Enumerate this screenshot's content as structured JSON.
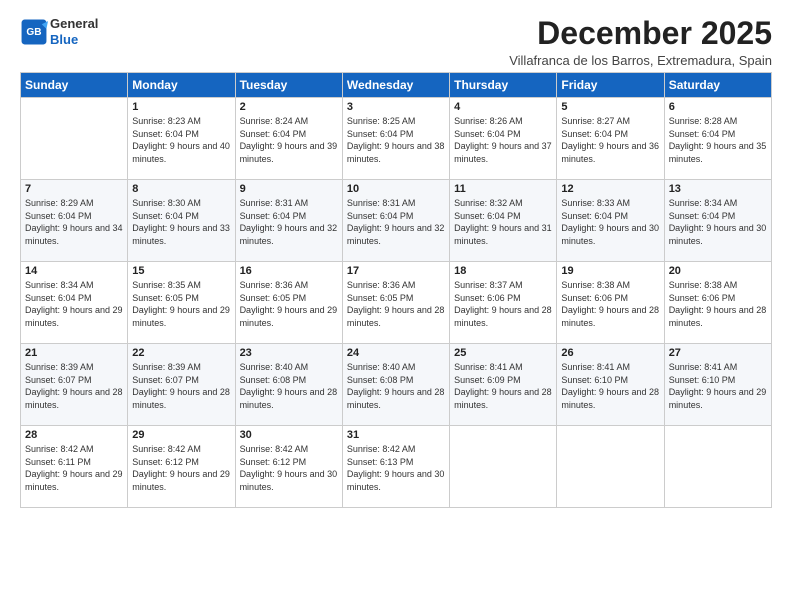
{
  "logo": {
    "line1": "General",
    "line2": "Blue"
  },
  "title": "December 2025",
  "subtitle": "Villafranca de los Barros, Extremadura, Spain",
  "days_of_week": [
    "Sunday",
    "Monday",
    "Tuesday",
    "Wednesday",
    "Thursday",
    "Friday",
    "Saturday"
  ],
  "weeks": [
    [
      {
        "day": "",
        "sunrise": "",
        "sunset": "",
        "daylight": ""
      },
      {
        "day": "1",
        "sunrise": "Sunrise: 8:23 AM",
        "sunset": "Sunset: 6:04 PM",
        "daylight": "Daylight: 9 hours and 40 minutes."
      },
      {
        "day": "2",
        "sunrise": "Sunrise: 8:24 AM",
        "sunset": "Sunset: 6:04 PM",
        "daylight": "Daylight: 9 hours and 39 minutes."
      },
      {
        "day": "3",
        "sunrise": "Sunrise: 8:25 AM",
        "sunset": "Sunset: 6:04 PM",
        "daylight": "Daylight: 9 hours and 38 minutes."
      },
      {
        "day": "4",
        "sunrise": "Sunrise: 8:26 AM",
        "sunset": "Sunset: 6:04 PM",
        "daylight": "Daylight: 9 hours and 37 minutes."
      },
      {
        "day": "5",
        "sunrise": "Sunrise: 8:27 AM",
        "sunset": "Sunset: 6:04 PM",
        "daylight": "Daylight: 9 hours and 36 minutes."
      },
      {
        "day": "6",
        "sunrise": "Sunrise: 8:28 AM",
        "sunset": "Sunset: 6:04 PM",
        "daylight": "Daylight: 9 hours and 35 minutes."
      }
    ],
    [
      {
        "day": "7",
        "sunrise": "Sunrise: 8:29 AM",
        "sunset": "Sunset: 6:04 PM",
        "daylight": "Daylight: 9 hours and 34 minutes."
      },
      {
        "day": "8",
        "sunrise": "Sunrise: 8:30 AM",
        "sunset": "Sunset: 6:04 PM",
        "daylight": "Daylight: 9 hours and 33 minutes."
      },
      {
        "day": "9",
        "sunrise": "Sunrise: 8:31 AM",
        "sunset": "Sunset: 6:04 PM",
        "daylight": "Daylight: 9 hours and 32 minutes."
      },
      {
        "day": "10",
        "sunrise": "Sunrise: 8:31 AM",
        "sunset": "Sunset: 6:04 PM",
        "daylight": "Daylight: 9 hours and 32 minutes."
      },
      {
        "day": "11",
        "sunrise": "Sunrise: 8:32 AM",
        "sunset": "Sunset: 6:04 PM",
        "daylight": "Daylight: 9 hours and 31 minutes."
      },
      {
        "day": "12",
        "sunrise": "Sunrise: 8:33 AM",
        "sunset": "Sunset: 6:04 PM",
        "daylight": "Daylight: 9 hours and 30 minutes."
      },
      {
        "day": "13",
        "sunrise": "Sunrise: 8:34 AM",
        "sunset": "Sunset: 6:04 PM",
        "daylight": "Daylight: 9 hours and 30 minutes."
      }
    ],
    [
      {
        "day": "14",
        "sunrise": "Sunrise: 8:34 AM",
        "sunset": "Sunset: 6:04 PM",
        "daylight": "Daylight: 9 hours and 29 minutes."
      },
      {
        "day": "15",
        "sunrise": "Sunrise: 8:35 AM",
        "sunset": "Sunset: 6:05 PM",
        "daylight": "Daylight: 9 hours and 29 minutes."
      },
      {
        "day": "16",
        "sunrise": "Sunrise: 8:36 AM",
        "sunset": "Sunset: 6:05 PM",
        "daylight": "Daylight: 9 hours and 29 minutes."
      },
      {
        "day": "17",
        "sunrise": "Sunrise: 8:36 AM",
        "sunset": "Sunset: 6:05 PM",
        "daylight": "Daylight: 9 hours and 28 minutes."
      },
      {
        "day": "18",
        "sunrise": "Sunrise: 8:37 AM",
        "sunset": "Sunset: 6:06 PM",
        "daylight": "Daylight: 9 hours and 28 minutes."
      },
      {
        "day": "19",
        "sunrise": "Sunrise: 8:38 AM",
        "sunset": "Sunset: 6:06 PM",
        "daylight": "Daylight: 9 hours and 28 minutes."
      },
      {
        "day": "20",
        "sunrise": "Sunrise: 8:38 AM",
        "sunset": "Sunset: 6:06 PM",
        "daylight": "Daylight: 9 hours and 28 minutes."
      }
    ],
    [
      {
        "day": "21",
        "sunrise": "Sunrise: 8:39 AM",
        "sunset": "Sunset: 6:07 PM",
        "daylight": "Daylight: 9 hours and 28 minutes."
      },
      {
        "day": "22",
        "sunrise": "Sunrise: 8:39 AM",
        "sunset": "Sunset: 6:07 PM",
        "daylight": "Daylight: 9 hours and 28 minutes."
      },
      {
        "day": "23",
        "sunrise": "Sunrise: 8:40 AM",
        "sunset": "Sunset: 6:08 PM",
        "daylight": "Daylight: 9 hours and 28 minutes."
      },
      {
        "day": "24",
        "sunrise": "Sunrise: 8:40 AM",
        "sunset": "Sunset: 6:08 PM",
        "daylight": "Daylight: 9 hours and 28 minutes."
      },
      {
        "day": "25",
        "sunrise": "Sunrise: 8:41 AM",
        "sunset": "Sunset: 6:09 PM",
        "daylight": "Daylight: 9 hours and 28 minutes."
      },
      {
        "day": "26",
        "sunrise": "Sunrise: 8:41 AM",
        "sunset": "Sunset: 6:10 PM",
        "daylight": "Daylight: 9 hours and 28 minutes."
      },
      {
        "day": "27",
        "sunrise": "Sunrise: 8:41 AM",
        "sunset": "Sunset: 6:10 PM",
        "daylight": "Daylight: 9 hours and 29 minutes."
      }
    ],
    [
      {
        "day": "28",
        "sunrise": "Sunrise: 8:42 AM",
        "sunset": "Sunset: 6:11 PM",
        "daylight": "Daylight: 9 hours and 29 minutes."
      },
      {
        "day": "29",
        "sunrise": "Sunrise: 8:42 AM",
        "sunset": "Sunset: 6:12 PM",
        "daylight": "Daylight: 9 hours and 29 minutes."
      },
      {
        "day": "30",
        "sunrise": "Sunrise: 8:42 AM",
        "sunset": "Sunset: 6:12 PM",
        "daylight": "Daylight: 9 hours and 30 minutes."
      },
      {
        "day": "31",
        "sunrise": "Sunrise: 8:42 AM",
        "sunset": "Sunset: 6:13 PM",
        "daylight": "Daylight: 9 hours and 30 minutes."
      },
      {
        "day": "",
        "sunrise": "",
        "sunset": "",
        "daylight": ""
      },
      {
        "day": "",
        "sunrise": "",
        "sunset": "",
        "daylight": ""
      },
      {
        "day": "",
        "sunrise": "",
        "sunset": "",
        "daylight": ""
      }
    ]
  ]
}
